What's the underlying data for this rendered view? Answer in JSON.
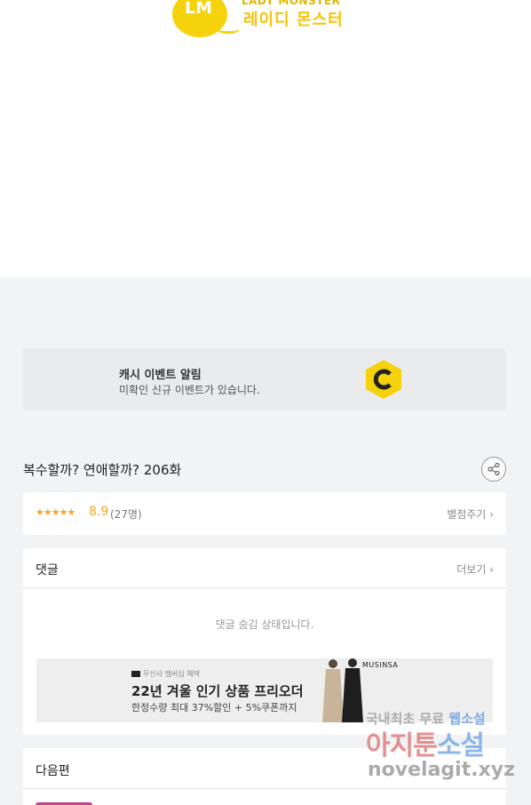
{
  "header": {
    "logo_mark": "LM",
    "logo_en": "LADY MONSTER",
    "logo_ko": "레이디 몬스터"
  },
  "cash_banner": {
    "title": "캐시 이벤트 알림",
    "subtitle": "미확인 신규 이벤트가 있습니다.",
    "icon": "cash-c-icon",
    "accent_color": "#f6d20c"
  },
  "episode": {
    "title": "복수할까? 연애할까? 206화"
  },
  "rating": {
    "stars_display": "★★★★★",
    "stars_value": 4.5,
    "score": "8.9",
    "count": "(27명)",
    "rate_button": "별점주기"
  },
  "comments": {
    "label": "댓글",
    "more_button": "더보기",
    "hidden_message": "댓글 숨김 상태입니다."
  },
  "ad": {
    "brand_small": "무신사 멤버십 혜택",
    "title": "22년 겨울 인기 상품 프리오더",
    "subtitle": "한정수량 최대 37%할인 + 5%쿠폰까지",
    "brand": "MUSINSA"
  },
  "next_episode": {
    "label": "다음편"
  },
  "watermark": {
    "line1_a": "국내최초 무료",
    "line1_b": "웹소설",
    "line2_a": "아지툰",
    "line2_b": "소설",
    "line3": "novelagit.xyz"
  },
  "colors": {
    "star": "#f5a623",
    "page_bg": "#f2f3f5"
  }
}
